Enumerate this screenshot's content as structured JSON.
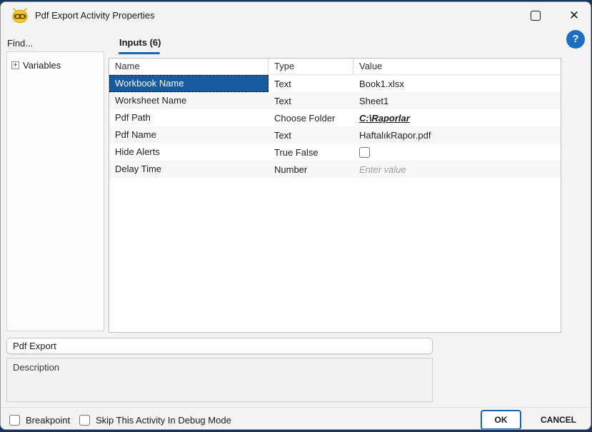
{
  "window": {
    "title": "Pdf Export Activity Properties",
    "close_glyph": "✕"
  },
  "sidebar": {
    "find_label": "Find...",
    "expander_glyph": "+",
    "tree": [
      {
        "label": "Variables"
      }
    ]
  },
  "tabs": {
    "inputs_label": "Inputs (6)"
  },
  "help": {
    "glyph": "?"
  },
  "table": {
    "columns": [
      "Name",
      "Type",
      "Value"
    ],
    "rows": [
      {
        "name": "Workbook Name",
        "type": "Text",
        "value": "Book1.xlsx",
        "value_kind": "text",
        "selected": true
      },
      {
        "name": "Worksheet Name",
        "type": "Text",
        "value": "Sheet1",
        "value_kind": "text"
      },
      {
        "name": "Pdf Path",
        "type": "Choose Folder",
        "value": "C:\\Raporlar",
        "value_kind": "link"
      },
      {
        "name": "Pdf Name",
        "type": "Text",
        "value": "HaftalıkRapor.pdf",
        "value_kind": "text"
      },
      {
        "name": "Hide Alerts",
        "type": "True False",
        "value": "",
        "value_kind": "checkbox",
        "checked": false
      },
      {
        "name": "Delay Time",
        "type": "Number",
        "value": "Enter value",
        "value_kind": "placeholder"
      }
    ]
  },
  "name_field": {
    "value": "Pdf Export"
  },
  "description_field": {
    "value": "Description"
  },
  "footer": {
    "breakpoint_label": "Breakpoint",
    "skip_label": "Skip This Activity In Debug Mode",
    "ok_label": "OK",
    "cancel_label": "CANCEL"
  },
  "colors": {
    "accent_blue": "#1b64b5",
    "selection_blue": "#175a9e",
    "help_blue": "#1b6ec2",
    "dialog_bg": "#f3f3f3",
    "window_edge": "#17375e"
  }
}
